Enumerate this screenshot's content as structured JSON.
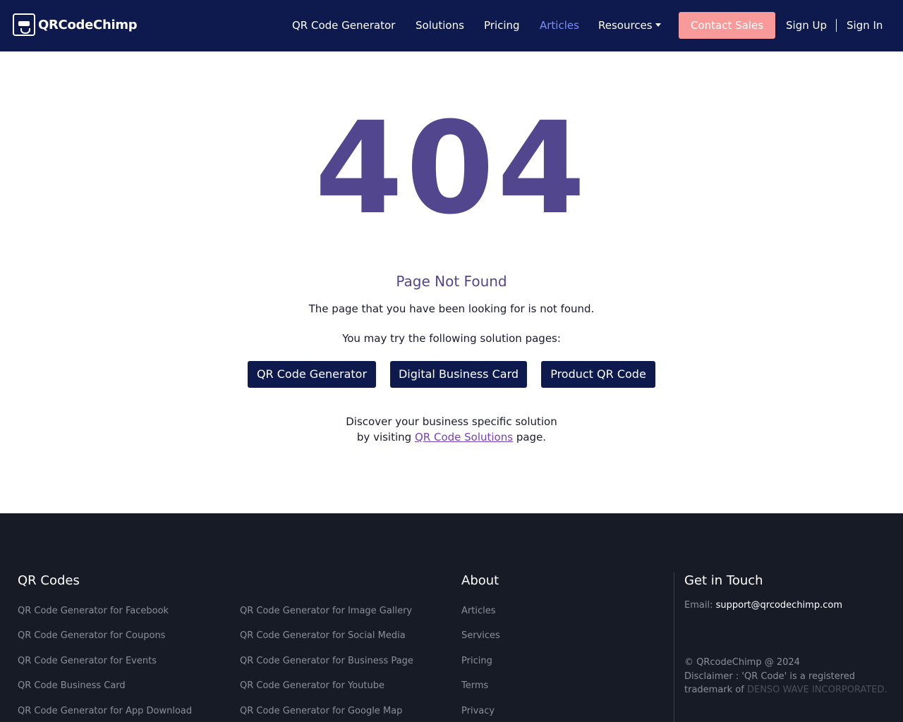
{
  "nav": {
    "logo_text": "QRCodeChimp",
    "items": [
      "QR Code Generator",
      "Solutions",
      "Pricing",
      "Articles",
      "Resources"
    ],
    "active": "Articles",
    "contact": "Contact Sales",
    "signup": "Sign Up",
    "signin": "Sign In"
  },
  "error": {
    "code": "404",
    "title": "Page Not Found",
    "message": "The page that you have been looking for is not found.",
    "try_label": "You may try the following solution pages:",
    "buttons": [
      "QR Code Generator",
      "Digital Business Card",
      "Product QR Code"
    ],
    "discover_line1": "Discover your business specific solution",
    "discover_prefix": "by visiting",
    "discover_link": "QR Code Solutions",
    "discover_suffix": "page."
  },
  "footer": {
    "qr_heading": "QR Codes",
    "qr_col1": [
      "QR Code Generator for Facebook",
      "QR Code Generator for Coupons",
      "QR Code Generator for Events",
      "QR Code Business Card",
      "QR Code Generator for App Download"
    ],
    "qr_col2": [
      "QR Code Generator for Image Gallery",
      "QR Code Generator for Social Media",
      "QR Code Generator for Business Page",
      "QR Code Generator for Youtube",
      "QR Code Generator for Google Map"
    ],
    "about_heading": "About",
    "about": [
      "Articles",
      "Services",
      "Pricing",
      "Terms",
      "Privacy"
    ],
    "contact_heading": "Get in Touch",
    "email_label": "Email:",
    "email": "support@qrcodechimp.com",
    "copyright": "© QRcodeChimp @ 2024",
    "disclaimer_1": "Disclaimer : 'QR Code' is a registered",
    "disclaimer_2": "trademark of",
    "disclaimer_3": "DENSO WAVE INCORPORATED."
  },
  "colors": {
    "nav_bg": "#0e1a4d",
    "accent": "#52468e",
    "contact_btn": "#f99a9a",
    "active_nav": "#7b8cff",
    "footer_bg": "#161b26"
  }
}
